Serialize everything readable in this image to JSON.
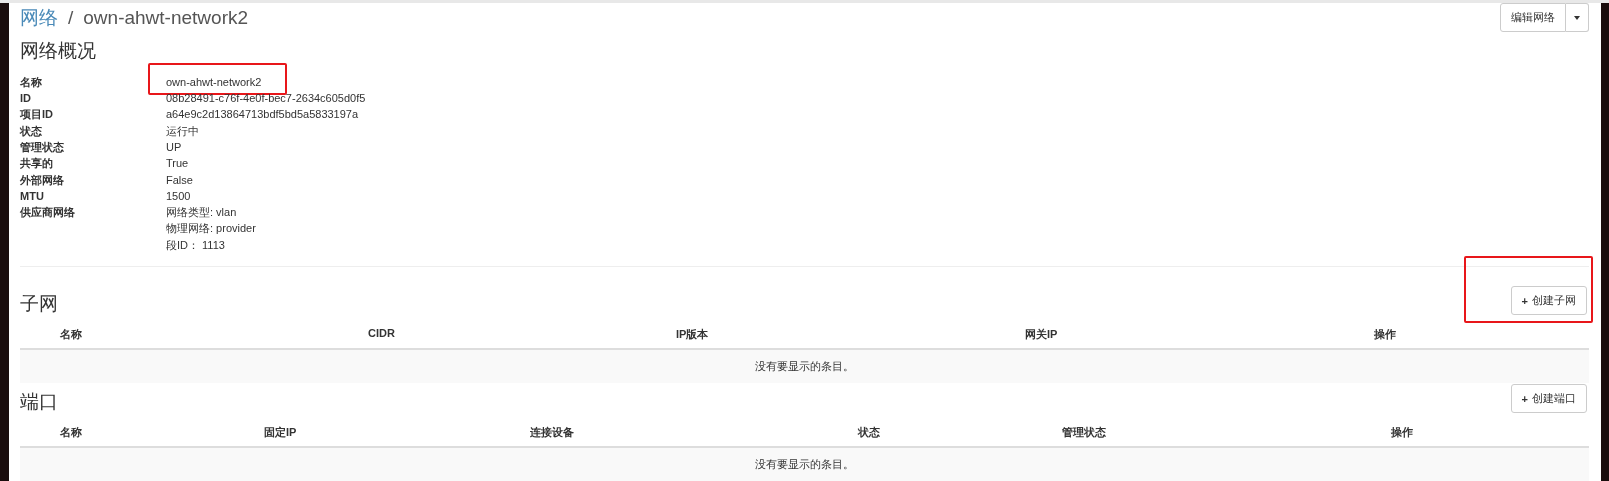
{
  "breadcrumb": {
    "parent": "网络",
    "separator": "/",
    "current": "own-ahwt-network2"
  },
  "header_actions": {
    "edit_button": "编辑网络",
    "dropdown": true
  },
  "overview": {
    "title": "网络概况",
    "fields": [
      {
        "label": "名称",
        "values": [
          "own-ahwt-network2"
        ],
        "highlighted": true
      },
      {
        "label": "ID",
        "values": [
          "08b28491-c76f-4e0f-bec7-2634c605d0f5"
        ],
        "highlighted": false
      },
      {
        "label": "项目ID",
        "values": [
          "a64e9c2d13864713bdf5bd5a5833197a"
        ],
        "highlighted": false
      },
      {
        "label": "状态",
        "values": [
          "运行中"
        ],
        "highlighted": false
      },
      {
        "label": "管理状态",
        "values": [
          "UP"
        ],
        "highlighted": false
      },
      {
        "label": "共享的",
        "values": [
          "True"
        ],
        "highlighted": false
      },
      {
        "label": "外部网络",
        "values": [
          "False"
        ],
        "highlighted": false
      },
      {
        "label": "MTU",
        "values": [
          "1500"
        ],
        "highlighted": false
      },
      {
        "label": "供应商网络",
        "values": [
          "网络类型: vlan",
          "物理网络: provider",
          "段ID： 1113"
        ],
        "highlighted": false
      }
    ]
  },
  "sections": [
    {
      "title": "子网",
      "button": {
        "icon": "+",
        "label": "创建子网",
        "highlighted": true
      },
      "columns": [
        "名称",
        "CIDR",
        "IP版本",
        "网关IP",
        "操作"
      ],
      "empty_message": "没有要显示的条目。"
    },
    {
      "title": "端口",
      "button": {
        "icon": "+",
        "label": "创建端口",
        "highlighted": false
      },
      "columns": [
        "名称",
        "固定IP",
        "连接设备",
        "状态",
        "管理状态",
        "操作"
      ],
      "empty_message": "没有要显示的条目。"
    }
  ]
}
